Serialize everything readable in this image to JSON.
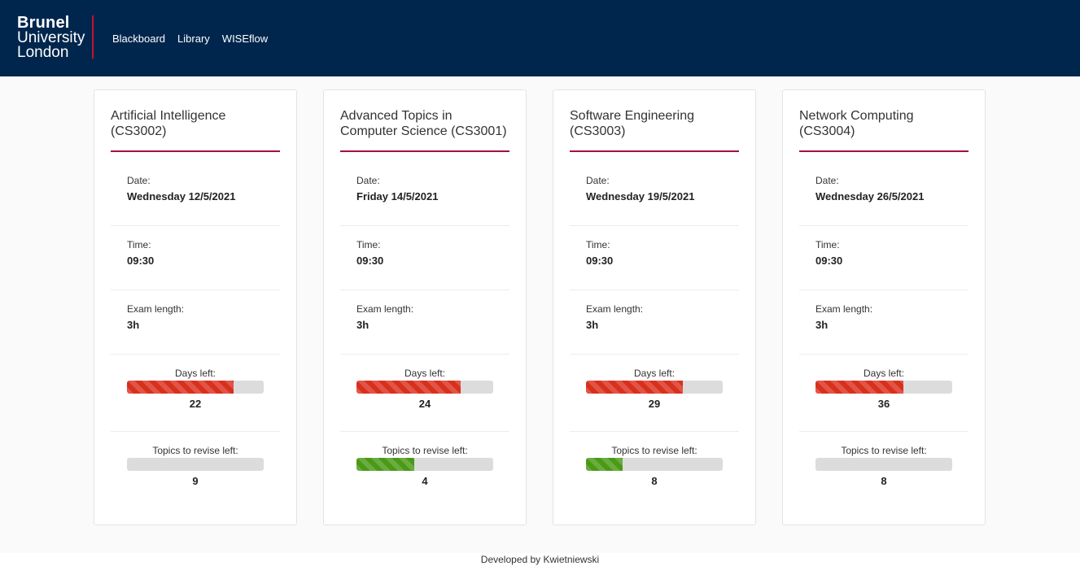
{
  "header": {
    "logo": [
      "Brunel",
      "University",
      "London"
    ],
    "nav": [
      "Blackboard",
      "Library",
      "WISEflow"
    ]
  },
  "cards": [
    {
      "title": "Artificial Intelligence (CS3002)",
      "date_label": "Date:",
      "date": "Wednesday 12/5/2021",
      "time_label": "Time:",
      "time": "09:30",
      "length_label": "Exam length:",
      "length": "3h",
      "days_label": "Days left:",
      "days": "22",
      "days_fraction": 0.78,
      "topics_label": "Topics to revise left:",
      "topics": "9",
      "topics_fraction": 0.0
    },
    {
      "title": "Advanced Topics in Computer Science (CS3001)",
      "date_label": "Date:",
      "date": "Friday 14/5/2021",
      "time_label": "Time:",
      "time": "09:30",
      "length_label": "Exam length:",
      "length": "3h",
      "days_label": "Days left:",
      "days": "24",
      "days_fraction": 0.76,
      "topics_label": "Topics to revise left:",
      "topics": "4",
      "topics_fraction": 0.42
    },
    {
      "title": "Software Engineering (CS3003)",
      "date_label": "Date:",
      "date": "Wednesday 19/5/2021",
      "time_label": "Time:",
      "time": "09:30",
      "length_label": "Exam length:",
      "length": "3h",
      "days_label": "Days left:",
      "days": "29",
      "days_fraction": 0.71,
      "topics_label": "Topics to revise left:",
      "topics": "8",
      "topics_fraction": 0.27
    },
    {
      "title": "Network Computing (CS3004)",
      "date_label": "Date:",
      "date": "Wednesday 26/5/2021",
      "time_label": "Time:",
      "time": "09:30",
      "length_label": "Exam length:",
      "length": "3h",
      "days_label": "Days left:",
      "days": "36",
      "days_fraction": 0.64,
      "topics_label": "Topics to revise left:",
      "topics": "8",
      "topics_fraction": 0.0
    }
  ],
  "footer": {
    "text": "Developed by Kwietniewski"
  },
  "colors": {
    "navbar": "#00264d",
    "accent": "#a0123a",
    "days_bar": "#d9301e",
    "topics_bar": "#4a9a16"
  }
}
